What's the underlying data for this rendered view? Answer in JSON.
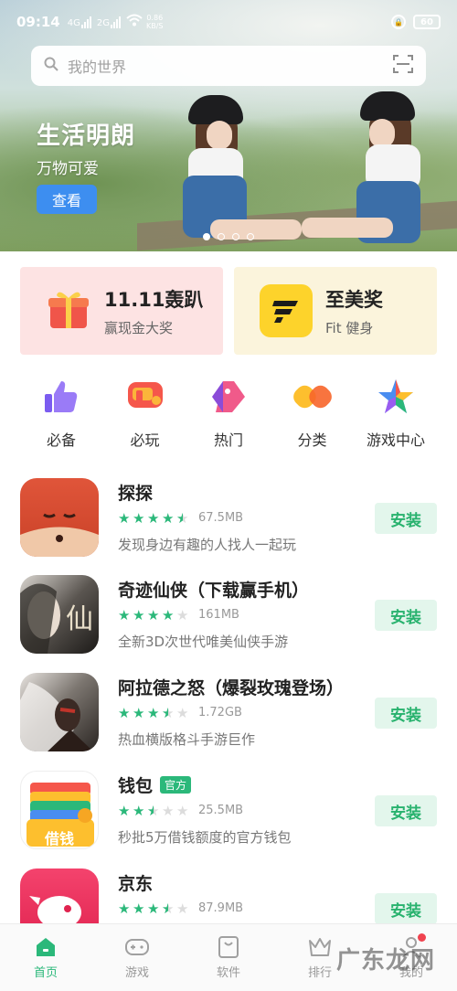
{
  "status_bar": {
    "time": "09:14",
    "signal1_label": "4G",
    "signal2_label": "2G",
    "net_speed": "0.86",
    "net_unit": "KB/S",
    "battery": "60"
  },
  "search": {
    "placeholder": "我的世界"
  },
  "banner": {
    "title": "生活明朗",
    "subtitle": "万物可爱",
    "button": "查看",
    "page_count": 4,
    "active_page": 1
  },
  "promos": [
    {
      "title": "11.11轰趴",
      "subtitle": "赢现金大奖"
    },
    {
      "title": "至美奖",
      "subtitle": "Fit 健身"
    }
  ],
  "categories": [
    {
      "label": "必备",
      "icon": "thumbs-up-icon"
    },
    {
      "label": "必玩",
      "icon": "gamepad-p-icon"
    },
    {
      "label": "热门",
      "icon": "tag-icon"
    },
    {
      "label": "分类",
      "icon": "category-icon"
    },
    {
      "label": "游戏中心",
      "icon": "star-icon"
    }
  ],
  "apps": [
    {
      "name": "探探",
      "tag": "",
      "rating": 4.5,
      "size": "67.5MB",
      "desc": "发现身边有趣的人找人一起玩",
      "action": "安装"
    },
    {
      "name": "奇迹仙侠（下载赢手机）",
      "tag": "",
      "rating": 4.0,
      "size": "161MB",
      "desc": "全新3D次世代唯美仙侠手游",
      "action": "安装"
    },
    {
      "name": "阿拉德之怒（爆裂玫瑰登场）",
      "tag": "",
      "rating": 3.5,
      "size": "1.72GB",
      "desc": "热血横版格斗手游巨作",
      "action": "安装"
    },
    {
      "name": "钱包",
      "tag": "官方",
      "rating": 2.5,
      "size": "25.5MB",
      "desc": "秒批5万借钱额度的官方钱包",
      "action": "安装"
    },
    {
      "name": "京东",
      "tag": "",
      "rating": 3.5,
      "size": "87.9MB",
      "desc": "",
      "action": "安装"
    }
  ],
  "wallet_icon_text": "借钱",
  "bottom_nav": [
    {
      "label": "首页",
      "active": true
    },
    {
      "label": "游戏",
      "active": false
    },
    {
      "label": "软件",
      "active": false
    },
    {
      "label": "排行",
      "active": false
    },
    {
      "label": "我的",
      "active": false
    }
  ],
  "watermark": "广东龙网",
  "colors": {
    "accent": "#2bb87a",
    "banner_button": "#3d8ef0",
    "promo_left_bg": "#fde3e3",
    "promo_right_bg": "#fbf4dc"
  }
}
